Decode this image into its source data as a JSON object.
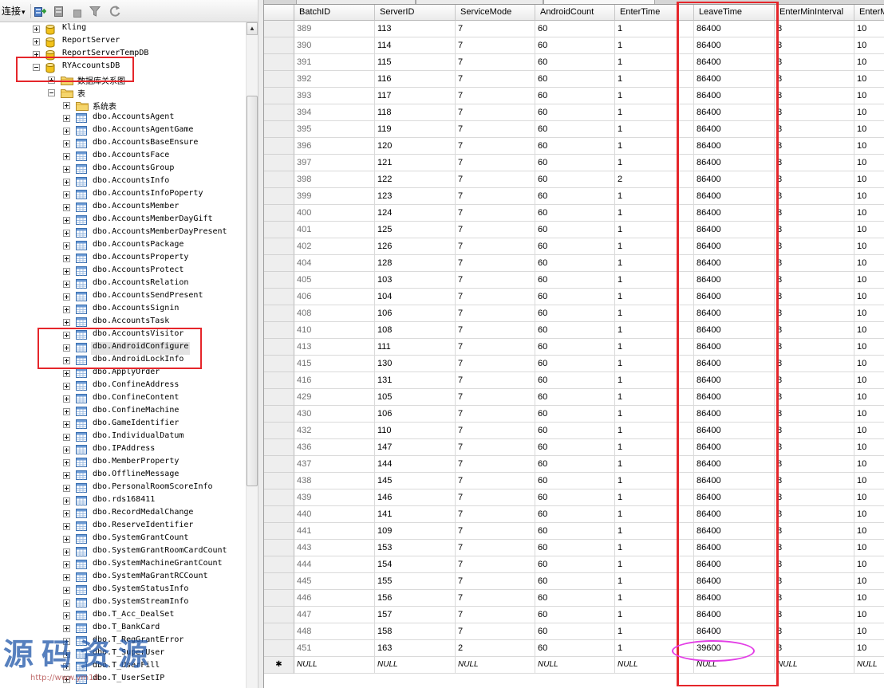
{
  "toolbar": {
    "connect_label": "连接",
    "dropdown_glyph": "▾",
    "icons": [
      "connect-object-icon",
      "disconnect-icon",
      "stop-icon",
      "filter-icon",
      "refresh-icon"
    ]
  },
  "tree": {
    "selected": "dbo.AndroidConfigure",
    "nodes": [
      {
        "label": "Kling",
        "type": "db",
        "depth": 0,
        "expanded": false
      },
      {
        "label": "ReportServer",
        "type": "db",
        "depth": 0,
        "expanded": false
      },
      {
        "label": "ReportServerTempDB",
        "type": "db",
        "depth": 0,
        "expanded": false
      },
      {
        "label": "RYAccountsDB",
        "type": "db",
        "depth": 0,
        "expanded": true
      },
      {
        "label": "数据库关系图",
        "type": "folder",
        "depth": 1,
        "expanded": false
      },
      {
        "label": "表",
        "type": "folder",
        "depth": 1,
        "expanded": true
      },
      {
        "label": "系统表",
        "type": "folder",
        "depth": 2,
        "expanded": false
      }
    ],
    "tables": [
      "dbo.AccountsAgent",
      "dbo.AccountsAgentGame",
      "dbo.AccountsBaseEnsure",
      "dbo.AccountsFace",
      "dbo.AccountsGroup",
      "dbo.AccountsInfo",
      "dbo.AccountsInfoPoperty",
      "dbo.AccountsMember",
      "dbo.AccountsMemberDayGift",
      "dbo.AccountsMemberDayPresent",
      "dbo.AccountsPackage",
      "dbo.AccountsProperty",
      "dbo.AccountsProtect",
      "dbo.AccountsRelation",
      "dbo.AccountsSendPresent",
      "dbo.AccountsSignin",
      "dbo.AccountsTask",
      "dbo.AccountsVisitor",
      "dbo.AndroidConfigure",
      "dbo.AndroidLockInfo",
      "dbo.ApplyOrder",
      "dbo.ConfineAddress",
      "dbo.ConfineContent",
      "dbo.ConfineMachine",
      "dbo.GameIdentifier",
      "dbo.IndividualDatum",
      "dbo.IPAddress",
      "dbo.MemberProperty",
      "dbo.OfflineMessage",
      "dbo.PersonalRoomScoreInfo",
      "dbo.rds168411",
      "dbo.RecordMedalChange",
      "dbo.ReserveIdentifier",
      "dbo.SystemGrantCount",
      "dbo.SystemGrantRoomCardCount",
      "dbo.SystemMachineGrantCount",
      "dbo.SystemMaGrantRCCount",
      "dbo.SystemStatusInfo",
      "dbo.SystemStreamInfo",
      "dbo.T_Acc_DealSet",
      "dbo.T_BankCard",
      "dbo.T_RegGrantError",
      "dbo.T_SuperUser",
      "dbo.T_UserFill",
      "dbo.T_UserSetIP"
    ]
  },
  "grid": {
    "columns": [
      "BatchID",
      "ServerID",
      "ServiceMode",
      "AndroidCount",
      "EnterTime",
      "LeaveTime",
      "EnterMinInterval",
      "EnterM"
    ],
    "identity_column": "BatchID",
    "rows": [
      [
        "389",
        "113",
        "7",
        "60",
        "1",
        "86400",
        "8",
        "10"
      ],
      [
        "390",
        "114",
        "7",
        "60",
        "1",
        "86400",
        "8",
        "10"
      ],
      [
        "391",
        "115",
        "7",
        "60",
        "1",
        "86400",
        "8",
        "10"
      ],
      [
        "392",
        "116",
        "7",
        "60",
        "1",
        "86400",
        "8",
        "10"
      ],
      [
        "393",
        "117",
        "7",
        "60",
        "1",
        "86400",
        "8",
        "10"
      ],
      [
        "394",
        "118",
        "7",
        "60",
        "1",
        "86400",
        "8",
        "10"
      ],
      [
        "395",
        "119",
        "7",
        "60",
        "1",
        "86400",
        "8",
        "10"
      ],
      [
        "396",
        "120",
        "7",
        "60",
        "1",
        "86400",
        "8",
        "10"
      ],
      [
        "397",
        "121",
        "7",
        "60",
        "1",
        "86400",
        "8",
        "10"
      ],
      [
        "398",
        "122",
        "7",
        "60",
        "2",
        "86400",
        "8",
        "10"
      ],
      [
        "399",
        "123",
        "7",
        "60",
        "1",
        "86400",
        "8",
        "10"
      ],
      [
        "400",
        "124",
        "7",
        "60",
        "1",
        "86400",
        "8",
        "10"
      ],
      [
        "401",
        "125",
        "7",
        "60",
        "1",
        "86400",
        "8",
        "10"
      ],
      [
        "402",
        "126",
        "7",
        "60",
        "1",
        "86400",
        "8",
        "10"
      ],
      [
        "404",
        "128",
        "7",
        "60",
        "1",
        "86400",
        "8",
        "10"
      ],
      [
        "405",
        "103",
        "7",
        "60",
        "1",
        "86400",
        "8",
        "10"
      ],
      [
        "406",
        "104",
        "7",
        "60",
        "1",
        "86400",
        "8",
        "10"
      ],
      [
        "408",
        "106",
        "7",
        "60",
        "1",
        "86400",
        "8",
        "10"
      ],
      [
        "410",
        "108",
        "7",
        "60",
        "1",
        "86400",
        "8",
        "10"
      ],
      [
        "413",
        "111",
        "7",
        "60",
        "1",
        "86400",
        "8",
        "10"
      ],
      [
        "415",
        "130",
        "7",
        "60",
        "1",
        "86400",
        "8",
        "10"
      ],
      [
        "416",
        "131",
        "7",
        "60",
        "1",
        "86400",
        "8",
        "10"
      ],
      [
        "429",
        "105",
        "7",
        "60",
        "1",
        "86400",
        "8",
        "10"
      ],
      [
        "430",
        "106",
        "7",
        "60",
        "1",
        "86400",
        "8",
        "10"
      ],
      [
        "432",
        "110",
        "7",
        "60",
        "1",
        "86400",
        "8",
        "10"
      ],
      [
        "436",
        "147",
        "7",
        "60",
        "1",
        "86400",
        "8",
        "10"
      ],
      [
        "437",
        "144",
        "7",
        "60",
        "1",
        "86400",
        "8",
        "10"
      ],
      [
        "438",
        "145",
        "7",
        "60",
        "1",
        "86400",
        "8",
        "10"
      ],
      [
        "439",
        "146",
        "7",
        "60",
        "1",
        "86400",
        "8",
        "10"
      ],
      [
        "440",
        "141",
        "7",
        "60",
        "1",
        "86400",
        "8",
        "10"
      ],
      [
        "441",
        "109",
        "7",
        "60",
        "1",
        "86400",
        "8",
        "10"
      ],
      [
        "443",
        "153",
        "7",
        "60",
        "1",
        "86400",
        "8",
        "10"
      ],
      [
        "444",
        "154",
        "7",
        "60",
        "1",
        "86400",
        "8",
        "10"
      ],
      [
        "445",
        "155",
        "7",
        "60",
        "1",
        "86400",
        "8",
        "10"
      ],
      [
        "446",
        "156",
        "7",
        "60",
        "1",
        "86400",
        "8",
        "10"
      ],
      [
        "447",
        "157",
        "7",
        "60",
        "1",
        "86400",
        "8",
        "10"
      ],
      [
        "448",
        "158",
        "7",
        "60",
        "1",
        "86400",
        "8",
        "10"
      ],
      [
        "451",
        "163",
        "2",
        "60",
        "1",
        "39600",
        "8",
        "10"
      ]
    ],
    "new_row_marker": "✱",
    "null_text": "NULL"
  },
  "scrollbar": {
    "up_glyph": "▲"
  },
  "colors": {
    "annotation_red": "#e5262b",
    "annotation_magenta": "#e33ee6",
    "identity_text": "#707070"
  },
  "watermark": {
    "text": "源码资源",
    "url": "http://www.ym18"
  }
}
